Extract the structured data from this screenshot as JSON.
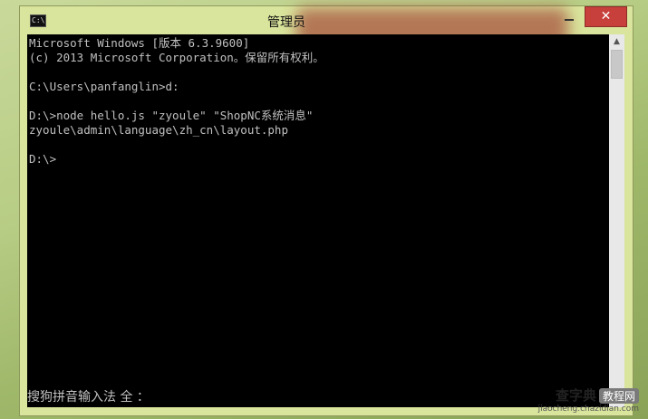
{
  "window": {
    "title": "管理员",
    "icon_label": "C:\\",
    "buttons": {
      "minimize": "minimize",
      "maximize": "maximize",
      "close": "✕"
    }
  },
  "console": {
    "lines": [
      "Microsoft Windows [版本 6.3.9600]",
      "(c) 2013 Microsoft Corporation。保留所有权利。",
      "",
      "C:\\Users\\panfanglin>d:",
      "",
      "D:\\>node hello.js \"zyoule\" \"ShopNC系统消息\"",
      "zyoule\\admin\\language\\zh_cn\\layout.php",
      "",
      "D:\\>"
    ],
    "ime_status": "搜狗拼音输入法 全 ："
  },
  "scrollbar": {
    "up": "▲",
    "down": "▼"
  },
  "watermark": {
    "main": "查字典",
    "badge": "教程网",
    "url": "jiaocheng.chazidian.com"
  }
}
